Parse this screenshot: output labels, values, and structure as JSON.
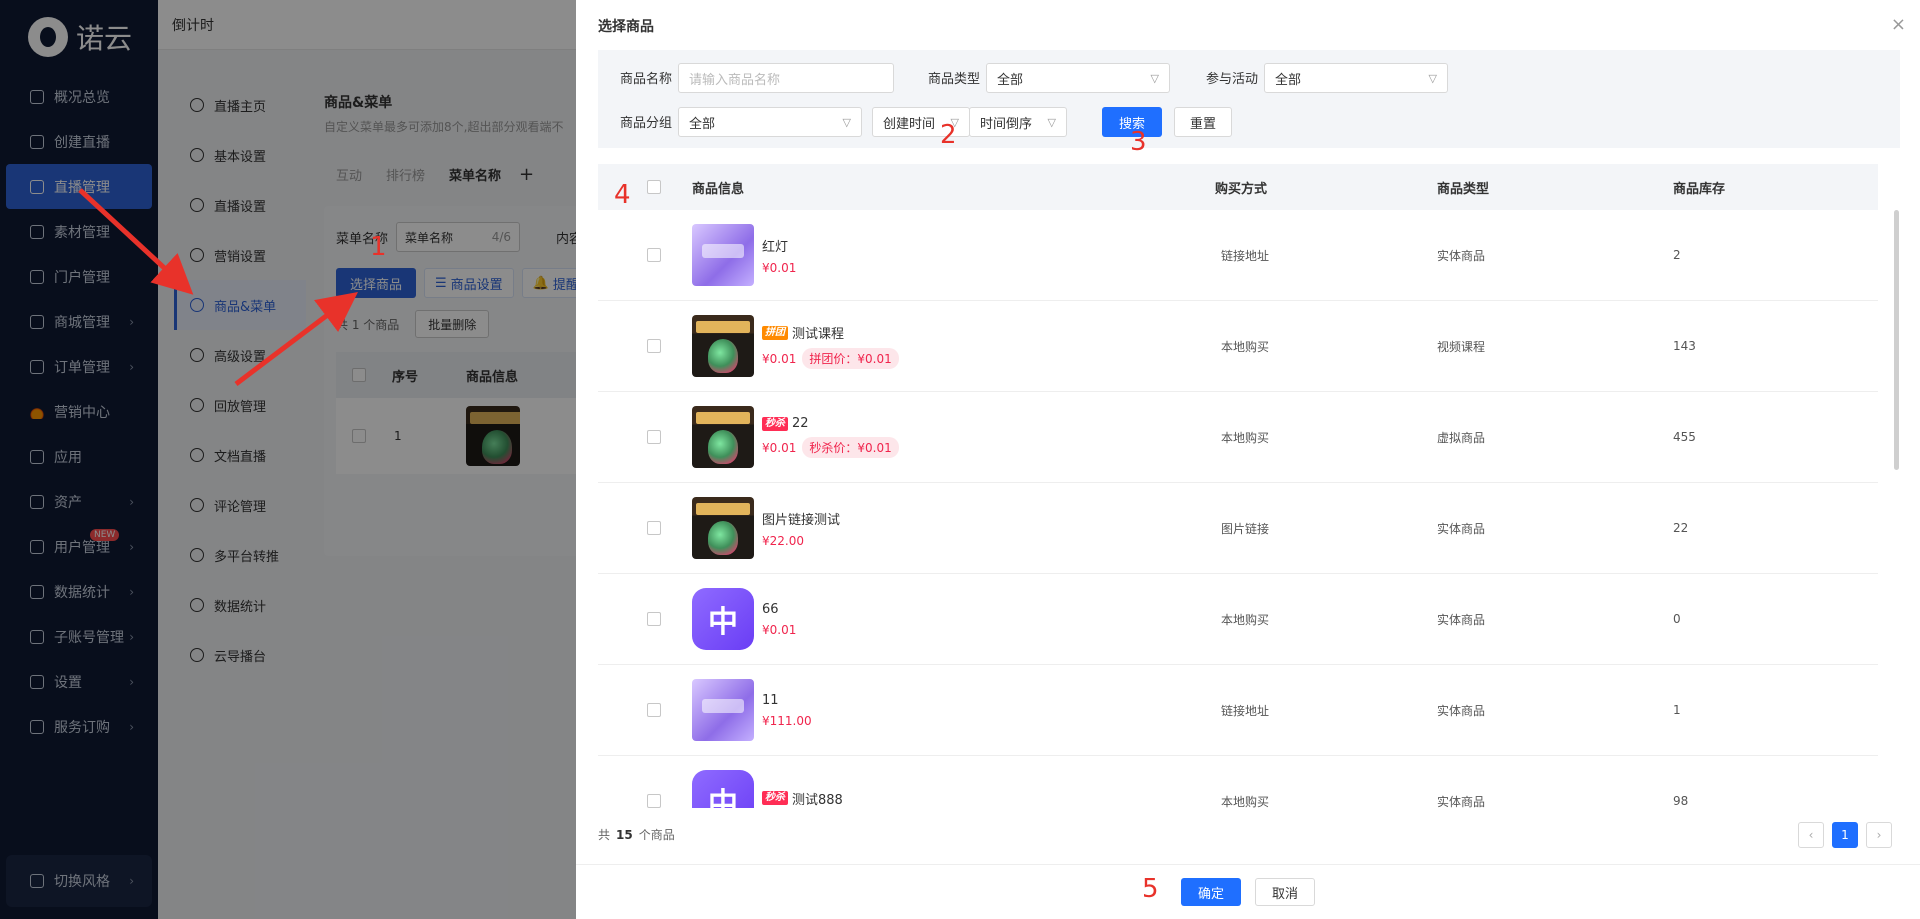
{
  "sidebar": {
    "brand": "诺云",
    "items": [
      {
        "label": "概况总览",
        "icon": "dashboard-icon",
        "arrow": false
      },
      {
        "label": "创建直播",
        "icon": "plus-calendar-icon",
        "arrow": false
      },
      {
        "label": "直播管理",
        "icon": "live-icon",
        "arrow": false,
        "active": true
      },
      {
        "label": "素材管理",
        "icon": "folder-icon",
        "arrow": false
      },
      {
        "label": "门户管理",
        "icon": "portal-icon",
        "arrow": false
      },
      {
        "label": "商城管理",
        "icon": "shop-icon",
        "arrow": true
      },
      {
        "label": "订单管理",
        "icon": "order-icon",
        "arrow": true
      },
      {
        "label": "营销中心",
        "icon": "fire-icon",
        "arrow": false
      },
      {
        "label": "应用",
        "icon": "apps-icon",
        "arrow": false
      },
      {
        "label": "资产",
        "icon": "asset-icon",
        "arrow": true
      },
      {
        "label": "用户管理",
        "icon": "user-icon",
        "arrow": true,
        "badge": "NEW"
      },
      {
        "label": "数据统计",
        "icon": "chart-icon",
        "arrow": true
      },
      {
        "label": "子账号管理",
        "icon": "subaccount-icon",
        "arrow": true
      },
      {
        "label": "设置",
        "icon": "gear-icon",
        "arrow": true
      },
      {
        "label": "服务订购",
        "icon": "service-icon",
        "arrow": true
      }
    ],
    "switch_style": "切换风格"
  },
  "topbar": {
    "title": "倒计时"
  },
  "submenu": {
    "items": [
      "直播主页",
      "基本设置",
      "直播设置",
      "营销设置",
      "商品&菜单",
      "高级设置",
      "回放管理",
      "文档直播",
      "评论管理",
      "多平台转推",
      "数据统计",
      "云导播台"
    ],
    "active_index": 4
  },
  "background": {
    "title": "商品&菜单",
    "desc": "自定义菜单最多可添加8个,超出部分观看端不",
    "tabs": [
      "互动",
      "排行榜",
      "菜单名称"
    ],
    "add_tab": "+",
    "menu_name_label": "菜单名称",
    "menu_name_value": "菜单名称",
    "menu_name_count": "4/6",
    "content_label": "内容",
    "select_goods": "选择商品",
    "goods_settings": "商品设置",
    "remind": "提醒",
    "count_text": "共 1 个商品",
    "batch_delete": "批量删除",
    "col_no": "序号",
    "col_info": "商品信息",
    "row_no": "1"
  },
  "drawer": {
    "title": "选择商品",
    "close": "×",
    "filters": {
      "name_label": "商品名称",
      "name_placeholder": "请输入商品名称",
      "type_label": "商品类型",
      "type_value": "全部",
      "activity_label": "参与活动",
      "activity_value": "全部",
      "group_label": "商品分组",
      "group_value": "全部",
      "sort_field": "创建时间",
      "sort_order": "时间倒序",
      "search": "搜索",
      "reset": "重置"
    },
    "columns": {
      "info": "商品信息",
      "buy": "购买方式",
      "type": "商品类型",
      "stock": "商品库存"
    },
    "rows": [
      {
        "name": "红灯",
        "tag": "",
        "price": "¥0.01",
        "pill": "",
        "buy": "链接地址",
        "type": "实体商品",
        "stock": "2",
        "thumb": "purple"
      },
      {
        "name": "测试课程",
        "tag": "拼团",
        "price": "¥0.01",
        "pill": "拼团价：¥0.01",
        "buy": "本地购买",
        "type": "视频课程",
        "stock": "143",
        "thumb": "dark"
      },
      {
        "name": "22",
        "tag": "秒杀",
        "price": "¥0.01",
        "pill": "秒杀价：¥0.01",
        "buy": "本地购买",
        "type": "虚拟商品",
        "stock": "455",
        "thumb": "dark"
      },
      {
        "name": "图片链接测试",
        "tag": "",
        "price": "¥22.00",
        "pill": "",
        "buy": "图片链接",
        "type": "实体商品",
        "stock": "22",
        "thumb": "dark"
      },
      {
        "name": "66",
        "tag": "",
        "price": "¥0.01",
        "pill": "",
        "buy": "本地购买",
        "type": "实体商品",
        "stock": "0",
        "thumb": "app"
      },
      {
        "name": "11",
        "tag": "",
        "price": "¥111.00",
        "pill": "",
        "buy": "链接地址",
        "type": "实体商品",
        "stock": "1",
        "thumb": "purple"
      },
      {
        "name": "测试888",
        "tag": "秒杀",
        "price": "",
        "pill": "",
        "buy": "本地购买",
        "type": "实体商品",
        "stock": "98",
        "thumb": "app"
      }
    ],
    "app_glyph": "中",
    "footer_prefix": "共",
    "footer_total": "15",
    "footer_suffix": "个商品",
    "pager": {
      "prev": "‹",
      "current": "1",
      "next": "›"
    },
    "confirm": "确定",
    "cancel": "取消"
  },
  "annotations": {
    "n1": "1",
    "n2": "2",
    "n3": "3",
    "n4": "4",
    "n5": "5"
  },
  "colors": {
    "accent": "#1f6fff",
    "sidebar_bg": "#0f1a33",
    "price_red": "#f0254d",
    "annotation_red": "#e8322a"
  }
}
